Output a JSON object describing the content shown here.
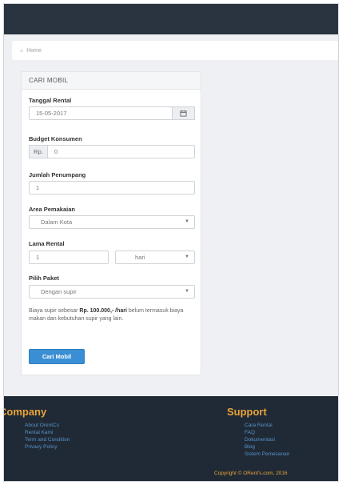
{
  "breadcrumb": {
    "icon": "home-icon",
    "label": "Home"
  },
  "panel": {
    "title": "CARI MOBIL"
  },
  "form": {
    "tanggal_rental": {
      "label": "Tanggal Rental",
      "value": "15-05-2017",
      "icon": "calendar-icon"
    },
    "budget": {
      "label": "Budget Konsumen",
      "prefix": "Rp.",
      "value": "0"
    },
    "jumlah": {
      "label": "Jumlah Penumpang",
      "value": "1"
    },
    "area": {
      "label": "Area Pemakaian",
      "value": "Dalam Kota"
    },
    "lama": {
      "label": "Lama Rental",
      "value": "1",
      "unit": "hari"
    },
    "paket": {
      "label": "Pilih Paket",
      "value": "Dengan supir"
    },
    "note_prefix": "Biaya supir sebesar ",
    "note_price": "Rp. 100.000,- /hari",
    "note_suffix": " belum termasuk biaya makan dan kebutuhan supir yang lain.",
    "submit_label": "Cari Mobil"
  },
  "footer": {
    "company_title": "Company",
    "company_links": [
      "About OrentCs",
      "Rental Kami",
      "Term and Condition",
      "Privacy Policy"
    ],
    "support_title": "Support",
    "support_links": [
      "Cara Rental",
      "FAQ",
      "Dokumentasi",
      "Blog",
      "Sistem Pemesanan"
    ],
    "copyright": "Copyright © ORent's.com, 2016"
  },
  "colors": {
    "navbar": "#2a3440",
    "footer": "#1f2a36",
    "accent_orange": "#e9a43a",
    "button_blue": "#3a8fd4",
    "link_blue": "#5a91c8"
  }
}
